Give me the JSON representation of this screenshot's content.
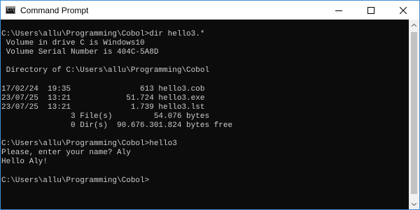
{
  "window": {
    "title": "Command Prompt",
    "icon_label": "C:\\",
    "icons": {
      "minimize": "minimize-icon",
      "maximize": "maximize-icon",
      "close": "close-icon"
    }
  },
  "console": {
    "lines": [
      "C:\\Users\\allu\\Programming\\Cobol>dir hello3.*",
      " Volume in drive C is Windows10",
      " Volume Serial Number is 404C-5A8D",
      "",
      " Directory of C:\\Users\\allu\\Programming\\Cobol",
      "",
      "17/02/24  19:35               613 hello3.cob",
      "23/07/25  13:21            51.724 hello3.exe",
      "23/07/25  13:21             1.739 hello3.lst",
      "               3 File(s)         54.076 bytes",
      "               0 Dir(s)  90.676.301.824 bytes free",
      "",
      "C:\\Users\\allu\\Programming\\Cobol>hello3",
      "Please, enter your name? Aly",
      "Hello Aly!",
      "",
      "C:\\Users\\allu\\Programming\\Cobol>"
    ]
  },
  "colors": {
    "console_bg": "#0c0c0c",
    "console_text": "#cccccc",
    "titlebar_bg": "#ffffff",
    "window_border": "#3c8fd6"
  }
}
